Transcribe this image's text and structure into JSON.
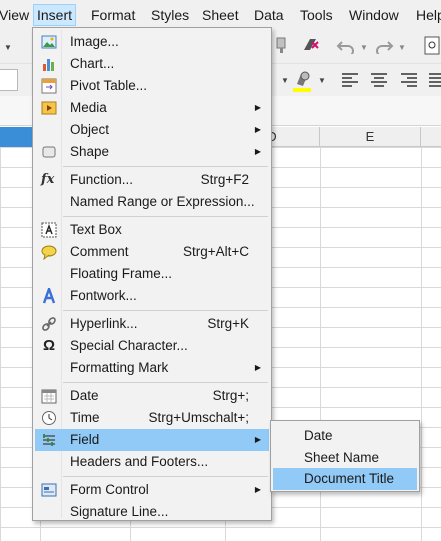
{
  "menubar": {
    "items": [
      {
        "label": "View"
      },
      {
        "label": "Insert"
      },
      {
        "label": "Format"
      },
      {
        "label": "Styles"
      },
      {
        "label": "Sheet"
      },
      {
        "label": "Data"
      },
      {
        "label": "Tools"
      },
      {
        "label": "Window"
      },
      {
        "label": "Help"
      }
    ]
  },
  "grid": {
    "columns": [
      "D",
      "E"
    ]
  },
  "insert_menu": {
    "items": [
      {
        "label": "Image...",
        "shortcut": "",
        "icon": "image-icon"
      },
      {
        "label": "Chart...",
        "shortcut": "",
        "icon": "chart-icon"
      },
      {
        "label": "Pivot Table...",
        "shortcut": "",
        "icon": "pivot-table-icon"
      },
      {
        "label": "Media",
        "shortcut": "",
        "icon": "media-icon",
        "submenu": true
      },
      {
        "label": "Object",
        "shortcut": "",
        "icon": "",
        "submenu": true
      },
      {
        "label": "Shape",
        "shortcut": "",
        "icon": "shape-icon",
        "submenu": true
      },
      {
        "label": "Function...",
        "shortcut": "Strg+F2",
        "icon": "function-icon"
      },
      {
        "label": "Named Range or Expression...",
        "shortcut": "",
        "icon": ""
      },
      {
        "label": "Text Box",
        "shortcut": "",
        "icon": "text-box-icon"
      },
      {
        "label": "Comment",
        "shortcut": "Strg+Alt+C",
        "icon": "comment-icon"
      },
      {
        "label": "Floating Frame...",
        "shortcut": "",
        "icon": ""
      },
      {
        "label": "Fontwork...",
        "shortcut": "",
        "icon": "fontwork-icon"
      },
      {
        "label": "Hyperlink...",
        "shortcut": "Strg+K",
        "icon": "hyperlink-icon"
      },
      {
        "label": "Special Character...",
        "shortcut": "",
        "icon": "omega-icon"
      },
      {
        "label": "Formatting Mark",
        "shortcut": "",
        "icon": "",
        "submenu": true
      },
      {
        "label": "Date",
        "shortcut": "Strg+;",
        "icon": "calendar-icon"
      },
      {
        "label": "Time",
        "shortcut": "Strg+Umschalt+;",
        "icon": "clock-icon"
      },
      {
        "label": "Field",
        "shortcut": "",
        "icon": "field-icon",
        "submenu": true
      },
      {
        "label": "Headers and Footers...",
        "shortcut": "",
        "icon": ""
      },
      {
        "label": "Form Control",
        "shortcut": "",
        "icon": "form-control-icon",
        "submenu": true
      },
      {
        "label": "Signature Line...",
        "shortcut": "",
        "icon": ""
      }
    ]
  },
  "field_submenu": {
    "items": [
      {
        "label": "Date"
      },
      {
        "label": "Sheet Name"
      },
      {
        "label": "Document Title"
      }
    ]
  },
  "colors": {
    "menu_highlight": "#91c9f7",
    "menubar_active": "#cce8ff",
    "selection_blue": "#3a8ed8",
    "highlighter_yellow": "#ffff00"
  }
}
